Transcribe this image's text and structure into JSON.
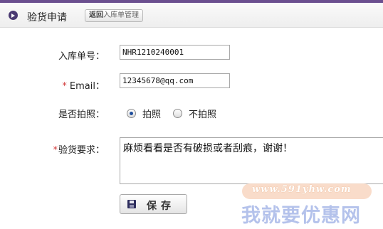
{
  "header": {
    "title": "验货申请",
    "back_prefix": "返回",
    "back_link_text": "入库单管理"
  },
  "form": {
    "order_label": "入库单号：",
    "order_value": "NHR1210240001",
    "email_required_mark": "*",
    "email_label": "Email：",
    "email_value": "12345678@qq.com",
    "photo_label": "是否拍照：",
    "photo_options": [
      {
        "label": "拍照",
        "checked": true
      },
      {
        "label": "不拍照",
        "checked": false
      }
    ],
    "requirement_required_mark": "*",
    "requirement_label": "验货要求：",
    "requirement_value": "麻烦看看是否有破损或者刮痕，谢谢！",
    "save_label": "保存"
  },
  "watermark": {
    "url": "www.591yhw.com",
    "text": "我就要优惠网"
  },
  "colors": {
    "accent": "#6b4f8f",
    "required": "#d23a3a",
    "radio_checked": "#1f4e9c"
  }
}
